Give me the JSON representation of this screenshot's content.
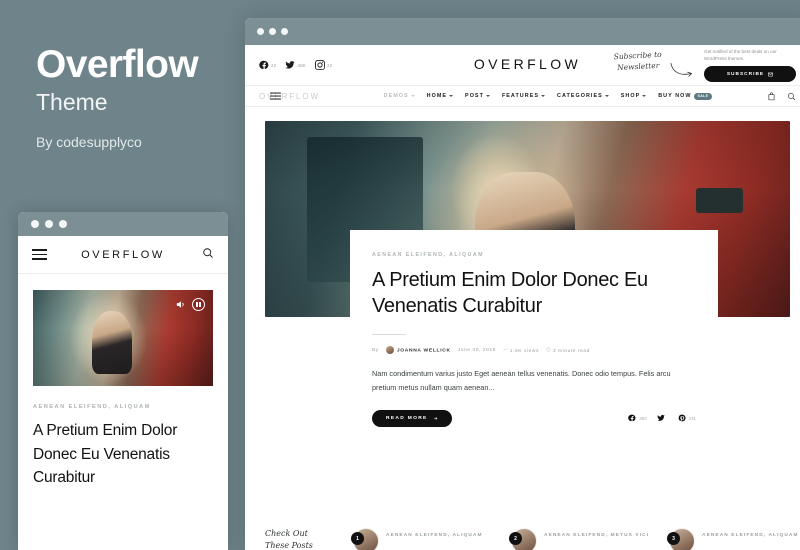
{
  "promo": {
    "title": "Overflow",
    "subtitle": "Theme",
    "byline": "By codesupplyco"
  },
  "desktop": {
    "brand": "OVERFLOW",
    "socials": [
      {
        "icon": "facebook-icon",
        "count": "22"
      },
      {
        "icon": "twitter-icon",
        "count": "48K"
      },
      {
        "icon": "instagram-icon",
        "count": "22"
      }
    ],
    "newsletter": {
      "script_line1": "Subscribe to",
      "script_line2": "Newsletter",
      "blurb": "Get notified of the best deals on our WordPress themes.",
      "button_label": "SUBSCRIBE"
    },
    "nav": {
      "logo": "OVERFLOW",
      "items": [
        {
          "label": "DEMOS",
          "caret": true,
          "dim": true
        },
        {
          "label": "HOME",
          "caret": true,
          "dim": false
        },
        {
          "label": "POST",
          "caret": true,
          "dim": false
        },
        {
          "label": "FEATURES",
          "caret": true,
          "dim": false
        },
        {
          "label": "CATEGORIES",
          "caret": true,
          "dim": false
        },
        {
          "label": "SHOP",
          "caret": true,
          "dim": false
        },
        {
          "label": "BUY NOW",
          "caret": false,
          "dim": false,
          "badge": "SALE"
        }
      ]
    },
    "article": {
      "category": "AENEAN ELEIFEND,  ALIQUAM",
      "title": "A Pretium Enim Dolor Donec Eu Venenatis Curabitur",
      "by_label": "By",
      "author": "JOANNA WELLICK",
      "date": "June 30, 2018",
      "views": "1.6K views",
      "read_time": "3 minute read",
      "excerpt": "Nam condimentum varius justo Eget aenean tellus venenatis. Donec odio tempus. Felis arcu pretium metus nullam quam aenean...",
      "read_more": "READ MORE",
      "shares": [
        {
          "icon": "facebook-icon",
          "count": "350"
        },
        {
          "icon": "twitter-icon",
          "count": ""
        },
        {
          "icon": "pinterest-icon",
          "count": "231"
        }
      ]
    },
    "strip": {
      "label_line1": "Check Out",
      "label_line2": "These Posts",
      "items": [
        {
          "number": "1",
          "category": "AENEAN ELEIFEND, ALIQUAM"
        },
        {
          "number": "2",
          "category": "AENEAN ELEIFEND, METUS VICI"
        },
        {
          "number": "3",
          "category": "AENEAN ELEIFEND, ALIQUAM"
        }
      ]
    }
  },
  "mobile": {
    "brand": "OVERFLOW",
    "category": "AENEAN ELEIFEND,  ALIQUAM",
    "title": "A Pretium Enim Dolor Donec Eu Venenatis Curabitur"
  },
  "colors": {
    "page_background": "#6e848a",
    "chrome": "#7b8f95",
    "accent_dark": "#111111",
    "badge": "#5d7a82"
  }
}
